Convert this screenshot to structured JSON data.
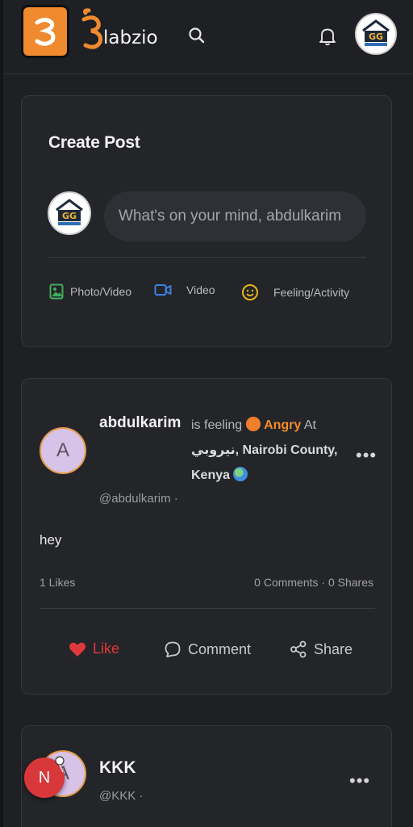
{
  "header": {
    "brand_name": "labzio",
    "brand_letter": "3",
    "avatar_text": "GG"
  },
  "create_post": {
    "title": "Create Post",
    "placeholder": "What's on your mind, abdulkarim",
    "actions": [
      {
        "label": "Photo/Video",
        "icon": "photo-icon",
        "color": "#3fae5a"
      },
      {
        "label": "Video",
        "icon": "video-camera-icon",
        "color": "#3d7fe0"
      },
      {
        "label": "Feeling/Activity",
        "icon": "smiley-icon",
        "color": "#e8b51f"
      }
    ]
  },
  "posts": [
    {
      "avatar_initial": "A",
      "username": "abdulkarim",
      "feeling_prefix": "is feeling",
      "feeling": "Angry",
      "at": "At",
      "location": "نيروبي, Nairobi County, Kenya",
      "handle": "@abdulkarim ·",
      "body": "hey",
      "likes": "1 Likes",
      "comments_shares": "0 Comments · 0 Shares",
      "like_label": "Like",
      "comment_label": "Comment",
      "share_label": "Share"
    },
    {
      "avatar_initial": "A",
      "username": "KKK",
      "handle": "@KKK ·"
    }
  ],
  "floating_badge": {
    "initial": "N"
  },
  "colors": {
    "background": "#1f2024",
    "card": "#242529",
    "accent_orange": "#f08a2e",
    "like_red": "#e0393b"
  }
}
